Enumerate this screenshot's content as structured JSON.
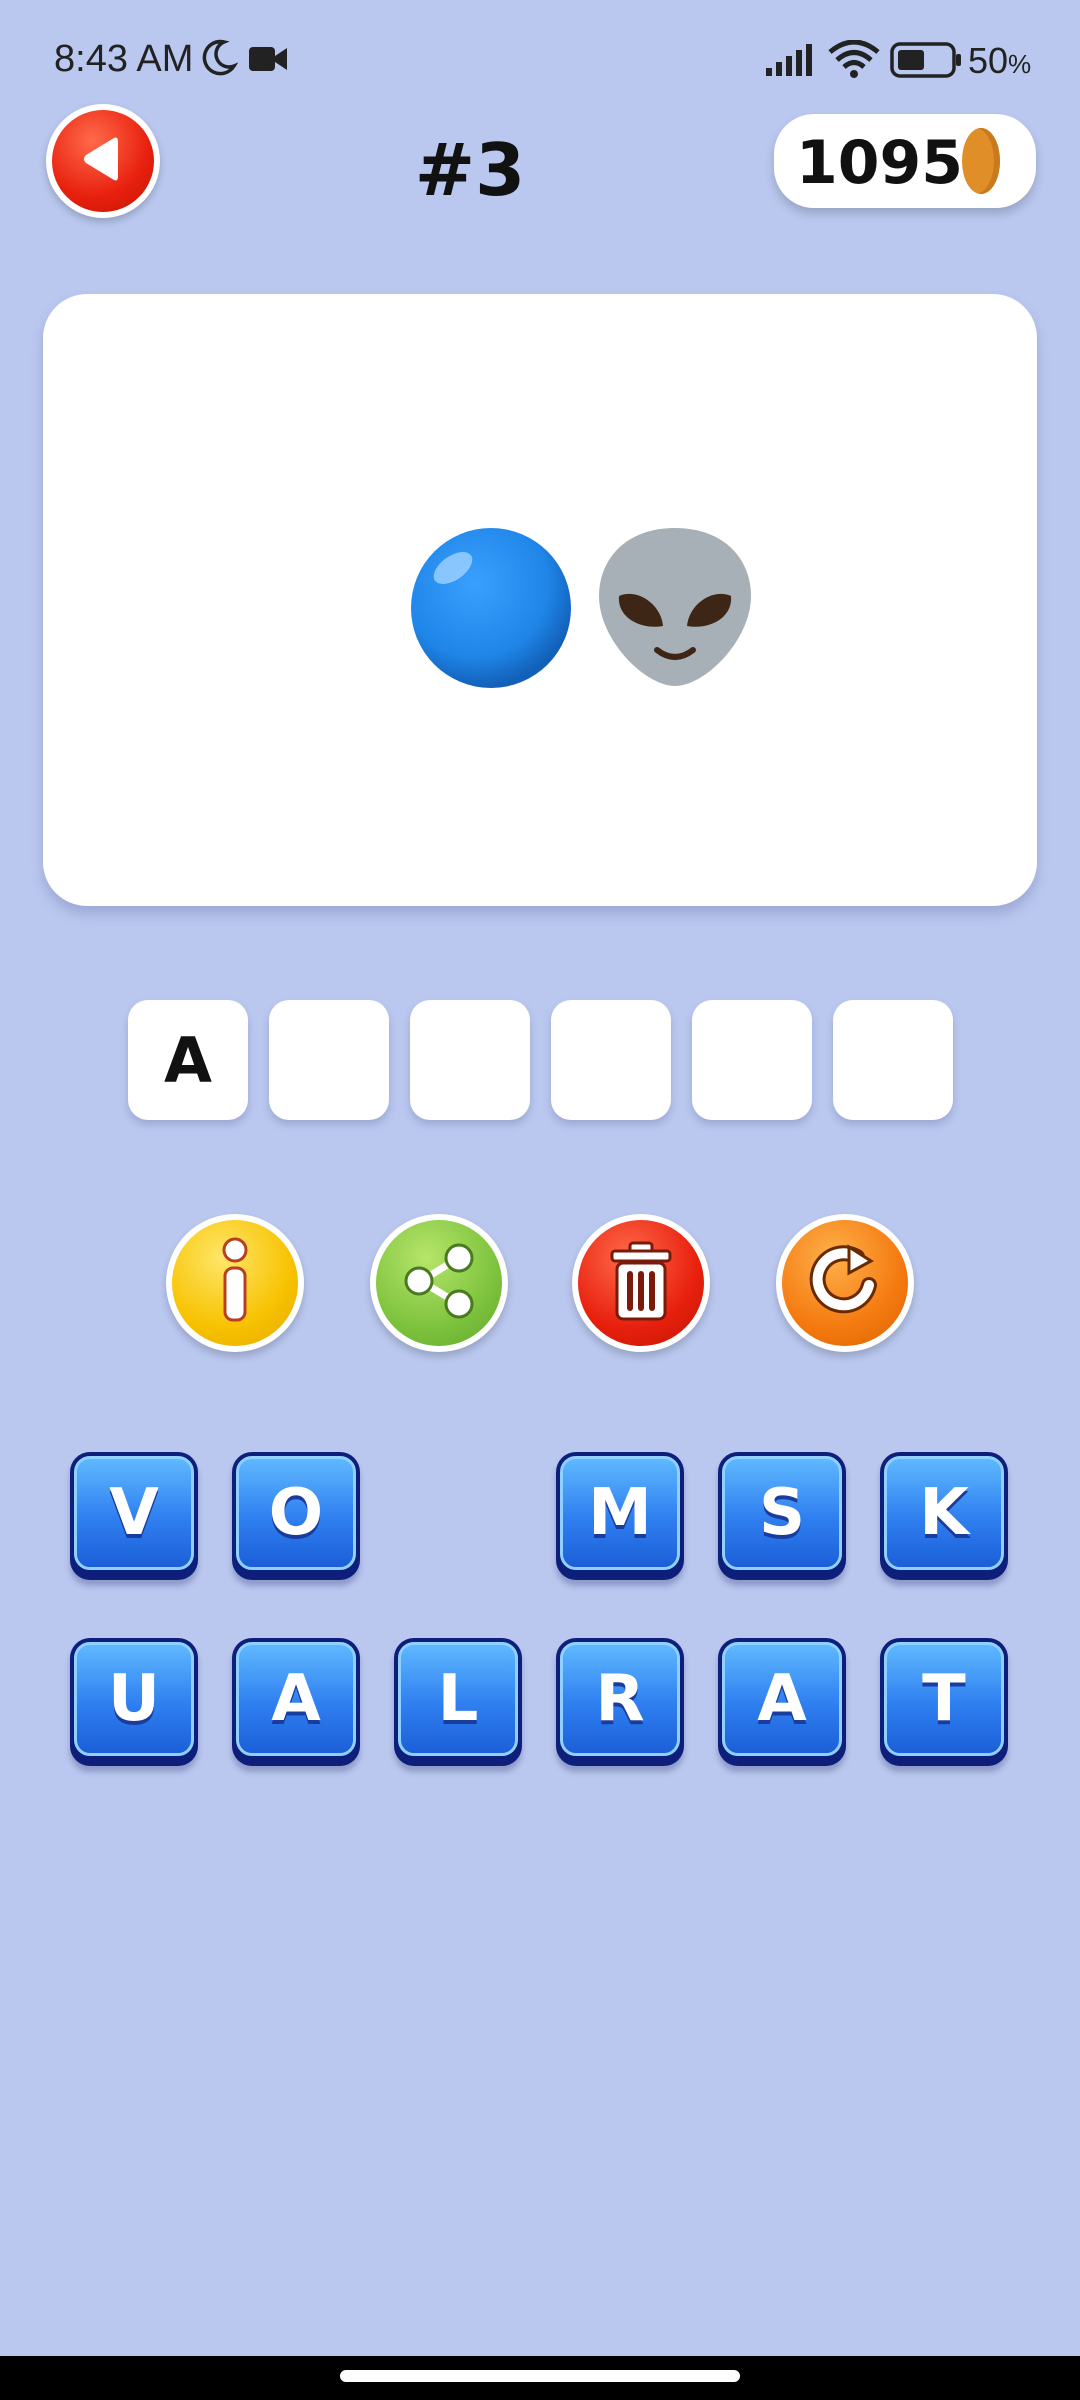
{
  "status_bar": {
    "time": "8:43 AM",
    "battery_percent": "50",
    "battery_unit": "%",
    "icons": [
      "moon-icon",
      "video-camera-icon",
      "signal-icon",
      "wifi-icon",
      "battery-icon"
    ]
  },
  "header": {
    "level": "#3",
    "coins": "1095",
    "back_icon": "back-arrow-icon",
    "coin_icon": "coin-icon"
  },
  "puzzle": {
    "emojis": [
      "blue-circle-emoji",
      "alien-emoji"
    ]
  },
  "answer": {
    "slots": [
      "A",
      "",
      "",
      "",
      "",
      ""
    ]
  },
  "tools": [
    {
      "name": "hint",
      "icon": "info-icon",
      "color": "#f7c200"
    },
    {
      "name": "share",
      "icon": "share-icon",
      "color": "#7ec33e"
    },
    {
      "name": "delete",
      "icon": "trash-icon",
      "color": "#e8200e"
    },
    {
      "name": "shuffle",
      "icon": "refresh-icon",
      "color": "#f47a10"
    }
  ],
  "letters": {
    "row1": [
      "V",
      "O",
      "",
      "M",
      "S",
      "K"
    ],
    "row2": [
      "U",
      "A",
      "L",
      "R",
      "A",
      "T"
    ]
  },
  "colors": {
    "background": "#bac8f0",
    "tile": "#2f7ff0"
  }
}
